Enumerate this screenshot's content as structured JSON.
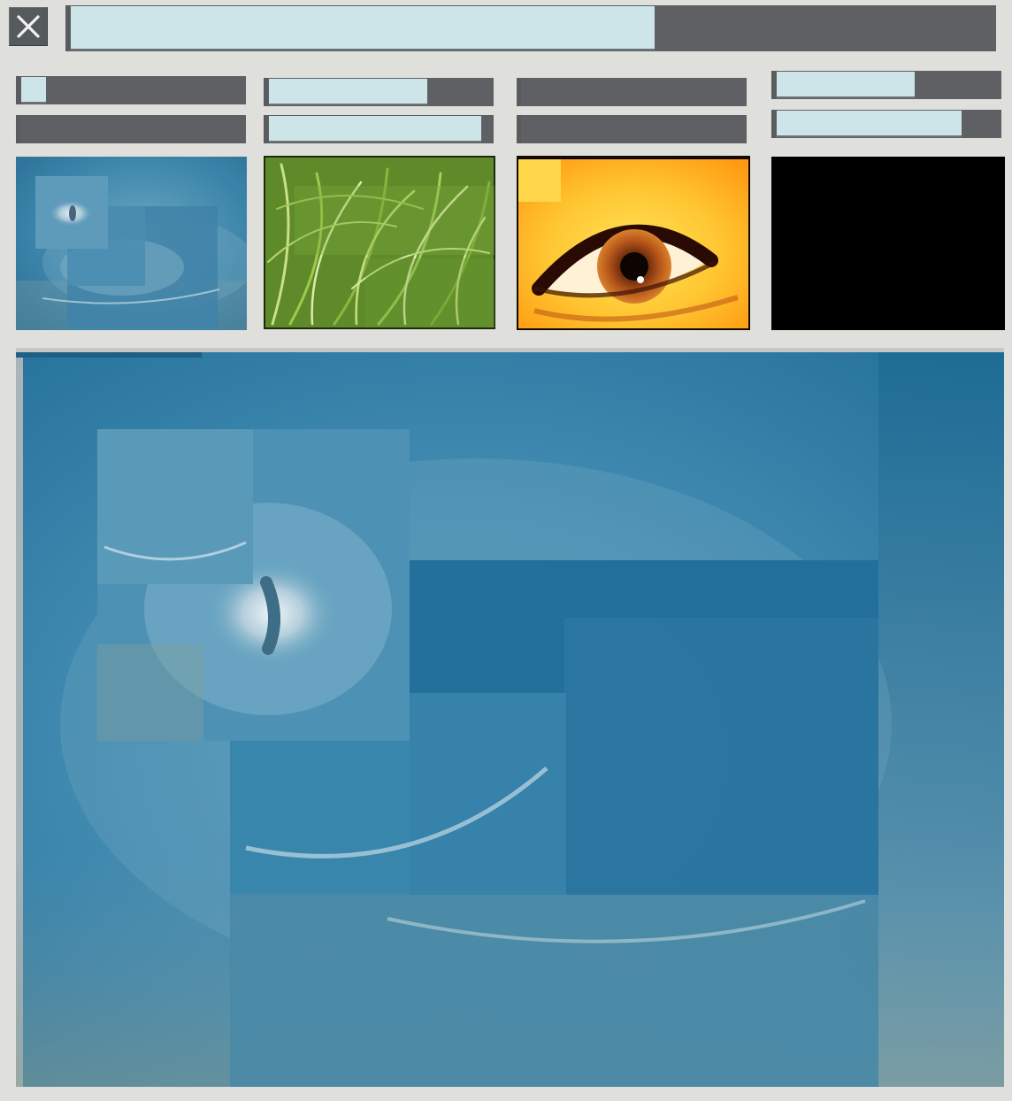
{
  "window": {
    "close_icon": "close-icon"
  },
  "top_progress": {
    "fill_fraction": 0.63
  },
  "mix_controls": [
    {
      "slot": "thumb-1",
      "bars": [
        0.11,
        0.0
      ]
    },
    {
      "slot": "thumb-2",
      "bars": [
        0.7,
        0.94
      ]
    },
    {
      "slot": "thumb-3",
      "bars": [
        0.0,
        0.0
      ]
    },
    {
      "slot": "thumb-4",
      "bars": [
        0.61,
        0.82
      ]
    }
  ],
  "thumbnails": [
    {
      "name": "inverted-eye-collage",
      "dominant_color": "#3f86ab"
    },
    {
      "name": "grass-collage",
      "dominant_color": "#7fa83a"
    },
    {
      "name": "eye-closeup",
      "dominant_color": "#ffcf3a"
    },
    {
      "name": "black-frame",
      "dominant_color": "#000000"
    }
  ],
  "preview": {
    "name": "inverted-eye-collage-large",
    "dominant_color": "#2e7ea6"
  },
  "colors": {
    "background": "#dfdfdb",
    "bar_track": "#5f6064",
    "bar_fill": "#cde5e8",
    "button": "#555b5d"
  }
}
